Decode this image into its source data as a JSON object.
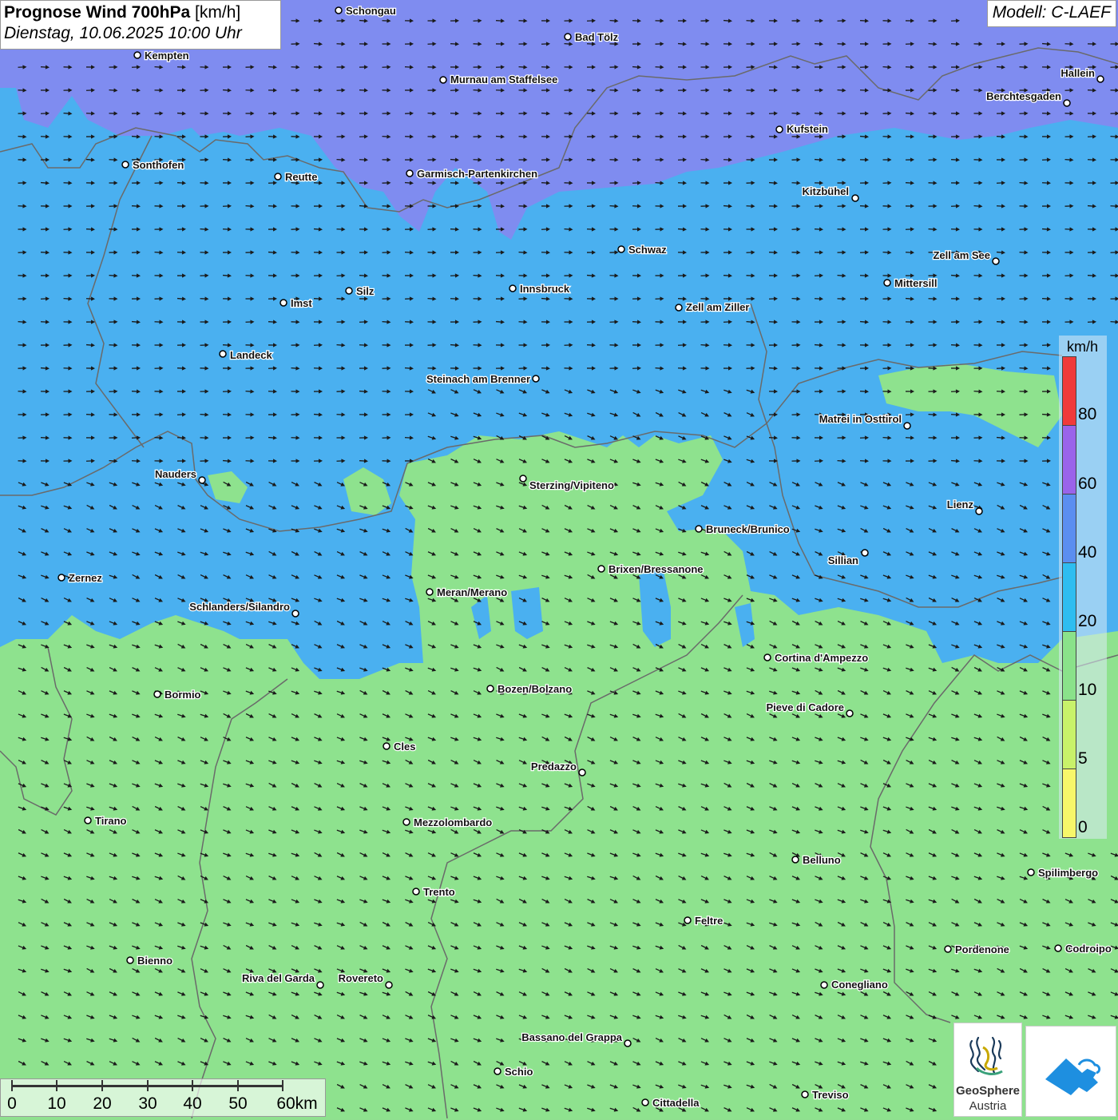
{
  "header": {
    "title_bold": "Prognose Wind 700hPa",
    "title_unit": "[km/h]",
    "datetime": "Dienstag, 10.06.2025 10:00 Uhr",
    "model": "Modell: C-LAEF"
  },
  "legend": {
    "unit": "km/h",
    "labels": [
      "80",
      "60",
      "40",
      "20",
      "10",
      "5",
      "0"
    ],
    "colors": {
      "c80": "#f03a3a",
      "c60": "#9a63ea",
      "c40": "#5b8ef0",
      "c20": "#2ebdf0",
      "c10": "#8ae28a",
      "c5": "#c8f26a",
      "c0": "#f7f76a"
    }
  },
  "map_colors": {
    "violet": "#7f8cf0",
    "blue": "#4ab0f0",
    "green": "#8ee28e",
    "border": "#6a6a6a"
  },
  "wind": {
    "north_direction": "east",
    "south_direction": "southeast",
    "north_speed_band": "20-40 km/h",
    "south_speed_band": "10-20 km/h"
  },
  "places": [
    {
      "name": "Schongau"
    },
    {
      "name": "Bad Tölz"
    },
    {
      "name": "Kempten"
    },
    {
      "name": "Murnau am Staffelsee"
    },
    {
      "name": "Hallein"
    },
    {
      "name": "Berchtesgaden"
    },
    {
      "name": "Kufstein"
    },
    {
      "name": "Sonthofen"
    },
    {
      "name": "Reutte"
    },
    {
      "name": "Garmisch-Partenkirchen"
    },
    {
      "name": "Kitzbühel"
    },
    {
      "name": "Schwaz"
    },
    {
      "name": "Zell am See"
    },
    {
      "name": "Innsbruck"
    },
    {
      "name": "Mittersill"
    },
    {
      "name": "Silz"
    },
    {
      "name": "Imst"
    },
    {
      "name": "Zell am Ziller"
    },
    {
      "name": "Landeck"
    },
    {
      "name": "Steinach am Brenner"
    },
    {
      "name": "Matrei in Osttirol"
    },
    {
      "name": "Nauders"
    },
    {
      "name": "Sterzing/Vipiteno"
    },
    {
      "name": "Lienz"
    },
    {
      "name": "Bruneck/Brunico"
    },
    {
      "name": "Sillian"
    },
    {
      "name": "Brixen/Bressanone"
    },
    {
      "name": "Zernez"
    },
    {
      "name": "Meran/Merano"
    },
    {
      "name": "Schlanders/Silandro"
    },
    {
      "name": "Cortina d'Ampezzo"
    },
    {
      "name": "Bozen/Bolzano"
    },
    {
      "name": "Bormio"
    },
    {
      "name": "Pieve di Cadore"
    },
    {
      "name": "Cles"
    },
    {
      "name": "Predazzo"
    },
    {
      "name": "Tirano"
    },
    {
      "name": "Mezzolombardo"
    },
    {
      "name": "Belluno"
    },
    {
      "name": "Spilimbergo"
    },
    {
      "name": "Trento"
    },
    {
      "name": "Feltre"
    },
    {
      "name": "Bienno"
    },
    {
      "name": "Pordenone"
    },
    {
      "name": "Codroipo"
    },
    {
      "name": "Riva del Garda"
    },
    {
      "name": "Rovereto"
    },
    {
      "name": "Conegliano"
    },
    {
      "name": "Bassano del Grappa"
    },
    {
      "name": "Schio"
    },
    {
      "name": "Treviso"
    },
    {
      "name": "Cittadella"
    }
  ],
  "scale_bar": {
    "labels": [
      "0",
      "10",
      "20",
      "30",
      "40",
      "50",
      "60km"
    ]
  },
  "logo": {
    "name_line1": "GeoSphere",
    "name_line2": "Austria"
  }
}
